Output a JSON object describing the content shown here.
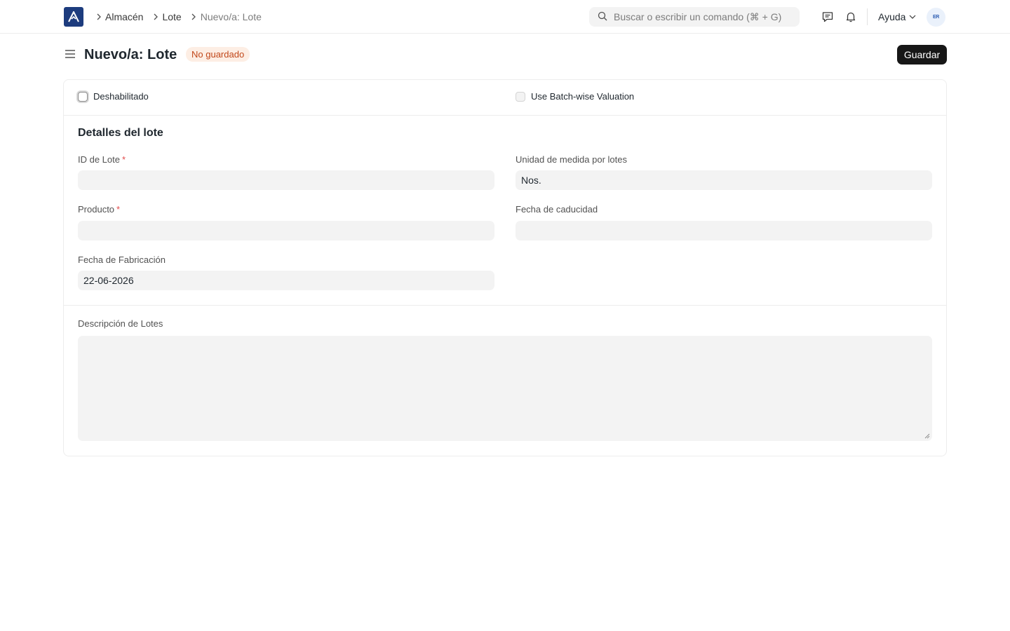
{
  "navbar": {
    "breadcrumbs": [
      "Almacén",
      "Lote",
      "Nuevo/a: Lote"
    ],
    "search_placeholder": "Buscar o escribir un comando (⌘ + G)",
    "help_label": "Ayuda",
    "avatar_initials": "ER"
  },
  "page": {
    "title": "Nuevo/a: Lote",
    "status_badge": "No guardado",
    "save_label": "Guardar"
  },
  "form": {
    "checkboxes": {
      "disabled_label": "Deshabilitado",
      "batchwise_label": "Use Batch-wise Valuation"
    },
    "details": {
      "section_title": "Detalles del lote",
      "batch_id_label": "ID de Lote",
      "batch_id_value": "",
      "uom_label": "Unidad de medida por lotes",
      "uom_value": "Nos.",
      "item_label": "Producto",
      "item_value": "",
      "expiry_label": "Fecha de caducidad",
      "expiry_value": "",
      "manufacturing_label": "Fecha de Fabricación",
      "manufacturing_value": "22-06-2026",
      "required_mark": "*"
    },
    "description": {
      "label": "Descripción de Lotes",
      "value": ""
    }
  },
  "colors": {
    "brand": "#1d3c7e",
    "badge_bg": "#fdeee4",
    "badge_text": "#c1471a",
    "primary_button": "#171717"
  }
}
